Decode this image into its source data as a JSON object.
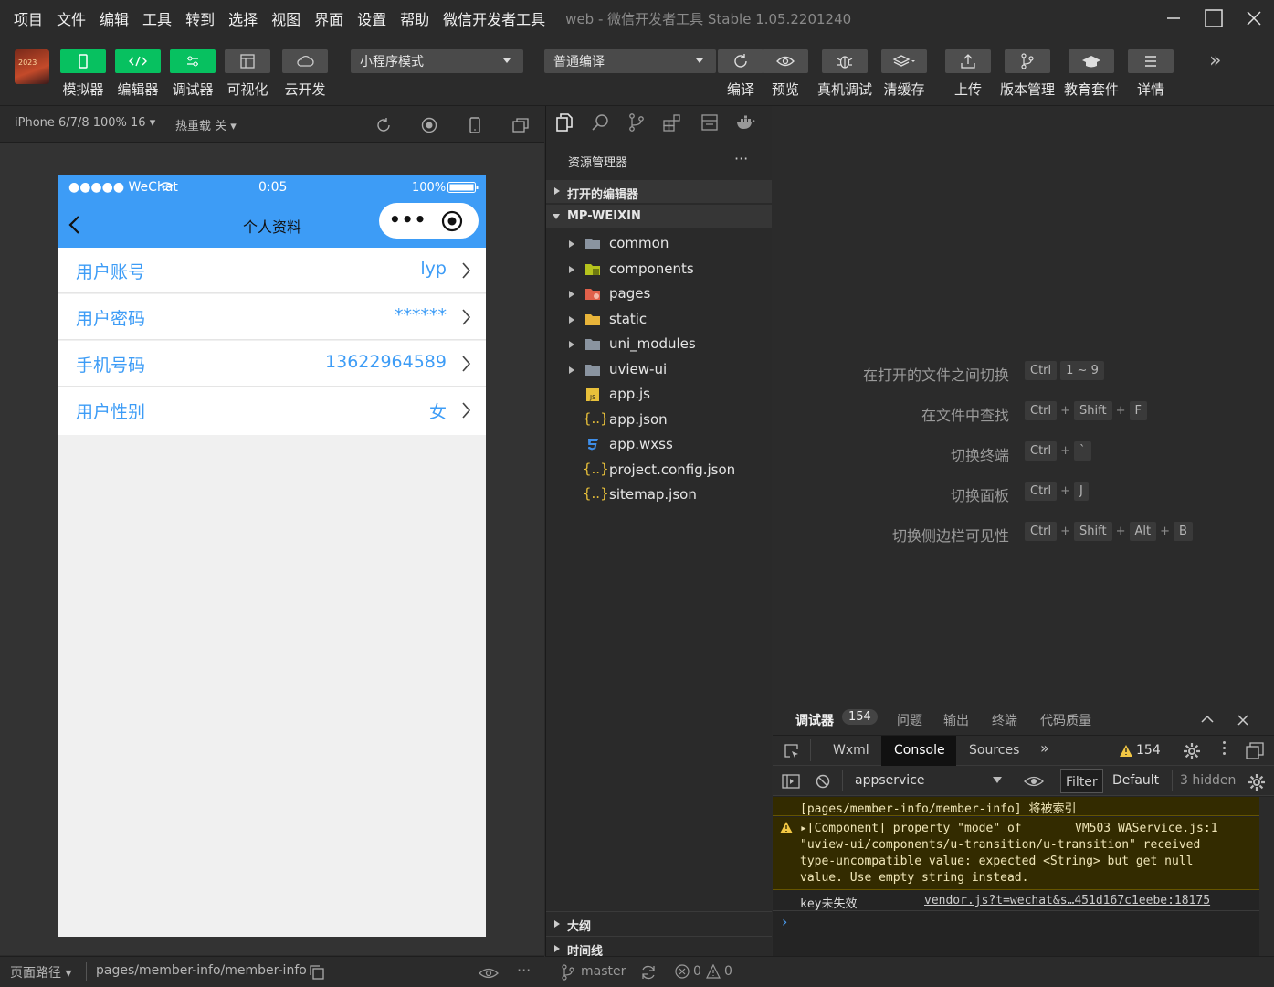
{
  "menu": {
    "items": [
      "项目",
      "文件",
      "编辑",
      "工具",
      "转到",
      "选择",
      "视图",
      "界面",
      "设置",
      "帮助",
      "微信开发者工具"
    ],
    "window_title": "web - 微信开发者工具 Stable 1.05.2201240"
  },
  "toolbar": {
    "avatar_text": "2023",
    "simulator_label": "模拟器",
    "editor_label": "编辑器",
    "debugger_label": "调试器",
    "visual_label": "可视化",
    "cloud_label": "云开发",
    "mode_select": "小程序模式",
    "compile_select": "普通编译",
    "compile_label": "编译",
    "preview_label": "预览",
    "device_debug_label": "真机调试",
    "clear_cache_label": "清缓存",
    "upload_label": "上传",
    "version_label": "版本管理",
    "edu_label": "教育套件",
    "details_label": "详情",
    "more_label": "»"
  },
  "simulator": {
    "device": "iPhone 6/7/8 100% 16 ▾",
    "hot_reload": "热重载 关 ▾",
    "status_signal": "●●●●● WeChat",
    "status_time": "0:05",
    "status_battery": "100%",
    "nav_title": "个人资料",
    "menu_dots": "•••",
    "rows": [
      {
        "label": "用户账号",
        "value": "lyp"
      },
      {
        "label": "用户密码",
        "value": "******"
      },
      {
        "label": "手机号码",
        "value": "13622964589"
      },
      {
        "label": "用户性别",
        "value": "女"
      }
    ],
    "page_path_label": "页面路径 ▾",
    "page_path": "pages/member-info/member-info",
    "status_more": "···"
  },
  "explorer": {
    "title": "资源管理器",
    "more": "···",
    "open_editors": "打开的编辑器",
    "root": "MP-WEIXIN",
    "folders": [
      "common",
      "components",
      "pages",
      "static",
      "uni_modules",
      "uview-ui"
    ],
    "files": [
      "app.js",
      "app.json",
      "app.wxss",
      "project.config.json",
      "sitemap.json"
    ],
    "outline": "大纲",
    "timeline": "时间线",
    "branch": "master",
    "errors": "0",
    "warnings": "0"
  },
  "shortcuts": [
    {
      "label": "在打开的文件之间切换",
      "keys": [
        "Ctrl",
        "1 ~ 9"
      ]
    },
    {
      "label": "在文件中查找",
      "keys": [
        "Ctrl",
        "Shift",
        "F"
      ]
    },
    {
      "label": "切换终端",
      "keys": [
        "Ctrl",
        "`"
      ]
    },
    {
      "label": "切换面板",
      "keys": [
        "Ctrl",
        "J"
      ]
    },
    {
      "label": "切换侧边栏可见性",
      "keys": [
        "Ctrl",
        "Shift",
        "Alt",
        "B"
      ]
    }
  ],
  "debugger": {
    "tabs": [
      "调试器",
      "问题",
      "输出",
      "终端",
      "代码质量"
    ],
    "badge": "154",
    "devtabs": [
      "Wxml",
      "Console",
      "Sources"
    ],
    "devtabs_more": "»",
    "warn_count": "154",
    "context": "appservice",
    "filter": "Filter",
    "level": "Default",
    "hidden": "3 hidden",
    "log1": "[pages/member-info/member-info] 将被索引",
    "warn_line1": "▸[Component] property \"mode\" of",
    "warn_line2": "\"uview-ui/components/u-transition/u-transition\" received",
    "warn_line3": "type-uncompatible value: expected <String> but get null",
    "warn_line4": "value. Use empty string instead.",
    "warn_link": "VM503 WAService.js:1",
    "log3": "key未失效",
    "log3_link": "vendor.js?t=wechat&s…451d167c1eebe:18175",
    "prompt": "›"
  },
  "colors": {
    "accent_green": "#07c160",
    "phone_blue": "#3d9cf6",
    "warning_bg": "#332b00"
  }
}
